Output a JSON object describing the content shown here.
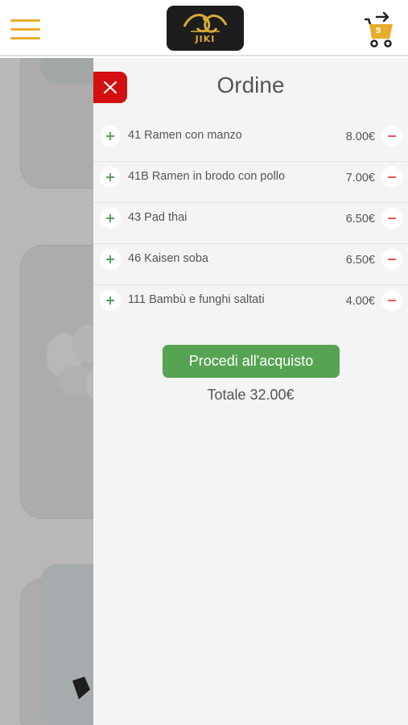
{
  "header": {
    "logo_text": "JIKI",
    "cart_count": "5"
  },
  "order": {
    "title": "Ordine",
    "items": [
      {
        "name": "41 Ramen con manzo",
        "price": "8.00€"
      },
      {
        "name": "41B Ramen in brodo con pollo",
        "price": "7.00€"
      },
      {
        "name": "43 Pad thai",
        "price": "6.50€"
      },
      {
        "name": "46 Kaisen soba",
        "price": "6.50€"
      },
      {
        "name": "111 Bambù e funghi saltati",
        "price": "4.00€"
      }
    ],
    "checkout_label": "Procedi all'acquisto",
    "total_label": "Totale 32.00€"
  },
  "colors": {
    "accent": "#e7ad2a",
    "close": "#d40f0f",
    "checkout": "#56a351",
    "plus": "#5aa05a",
    "minus": "#e25a5a"
  },
  "icons": [
    "menu-icon",
    "cart-icon",
    "close-icon",
    "plus-icon",
    "minus-icon"
  ]
}
